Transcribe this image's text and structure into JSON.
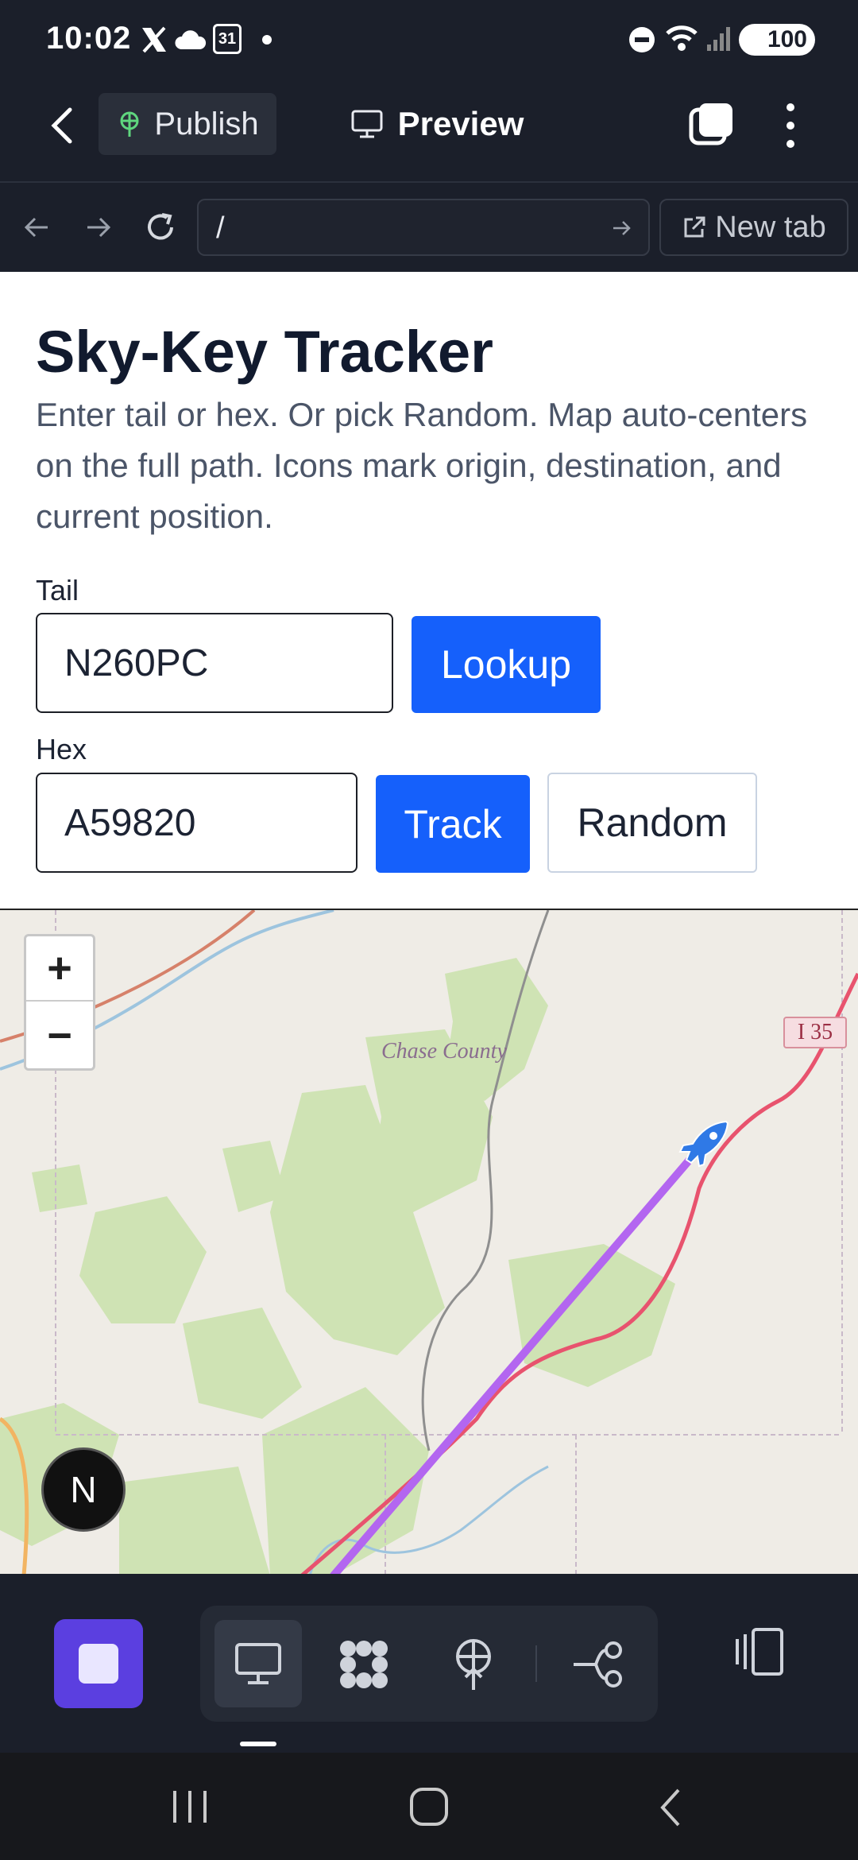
{
  "status_bar": {
    "time": "10:02",
    "calendar_date": "31",
    "battery": "100"
  },
  "top_bar": {
    "publish_label": "Publish",
    "preview_label": "Preview"
  },
  "nav_bar": {
    "url": "/",
    "new_tab_label": "New tab"
  },
  "page": {
    "title": "Sky-Key Tracker",
    "description": "Enter tail or hex. Or pick Random. Map auto-centers on the full path. Icons mark origin, destination, and current position.",
    "tail_label": "Tail",
    "tail_value": "N260PC",
    "lookup_label": "Lookup",
    "hex_label": "Hex",
    "hex_value": "A59820",
    "track_label": "Track",
    "random_label": "Random"
  },
  "map": {
    "zoom_in": "+",
    "zoom_out": "−",
    "county_label": "Chase County",
    "highway_label": "I 35",
    "avatar_letter": "N"
  },
  "colors": {
    "primary": "#1560fb",
    "path": "#b366f0",
    "highway": "#e8536e",
    "accent": "#5b3fe0"
  }
}
